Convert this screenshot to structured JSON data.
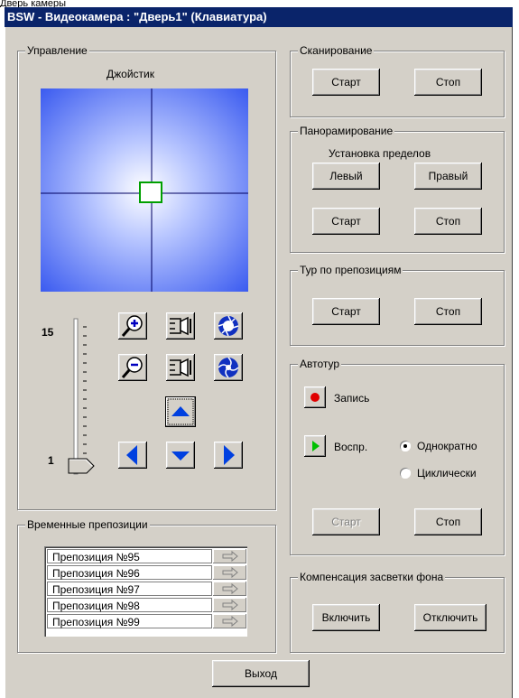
{
  "top_cut_text": "Дверь камеры",
  "window": {
    "title": "BSW - Видеокамера : \"Дверь1\" (Клавиатура)"
  },
  "control": {
    "legend": "Управление",
    "joystick_label": "Джойстик",
    "slider_max": "15",
    "slider_min": "1"
  },
  "presets": {
    "legend": "Временные препозиции",
    "items": [
      "Препозиция №95",
      "Препозиция №96",
      "Препозиция №97",
      "Препозиция №98",
      "Препозиция №99"
    ]
  },
  "scan": {
    "legend": "Сканирование",
    "start": "Старт",
    "stop": "Стоп"
  },
  "pan": {
    "legend": "Панорамирование",
    "limits_label": "Установка пределов",
    "left": "Левый",
    "right": "Правый",
    "start": "Старт",
    "stop": "Стоп"
  },
  "tour": {
    "legend": "Тур по препозициям",
    "start": "Старт",
    "stop": "Стоп"
  },
  "autotour": {
    "legend": "Автотур",
    "record": "Запись",
    "play": "Воспр.",
    "once": "Однократно",
    "cyclic": "Циклически",
    "mode_selected": "Однократно",
    "start": "Старт",
    "stop": "Стоп"
  },
  "backlight": {
    "legend": "Компенсация засветки фона",
    "on": "Включить",
    "off": "Отключить"
  },
  "exit": "Выход",
  "icons": {
    "zoom_in": "zoom-in-icon",
    "zoom_out": "zoom-out-icon",
    "focus": "camera-focus-icon",
    "iris_open": "iris-open-icon",
    "iris_close": "iris-close-icon",
    "up": "arrow-up-icon",
    "down": "arrow-down-icon",
    "left": "arrow-left-icon",
    "right": "arrow-right-icon",
    "record": "record-dot-icon",
    "play": "play-icon",
    "preset_go": "arrow-right-outline-icon"
  },
  "colors": {
    "title_bar": "#0a246a",
    "arrow": "#0040e0",
    "record": "#e00000",
    "play": "#00c000",
    "joystick_edge": "#3c5cf0"
  }
}
